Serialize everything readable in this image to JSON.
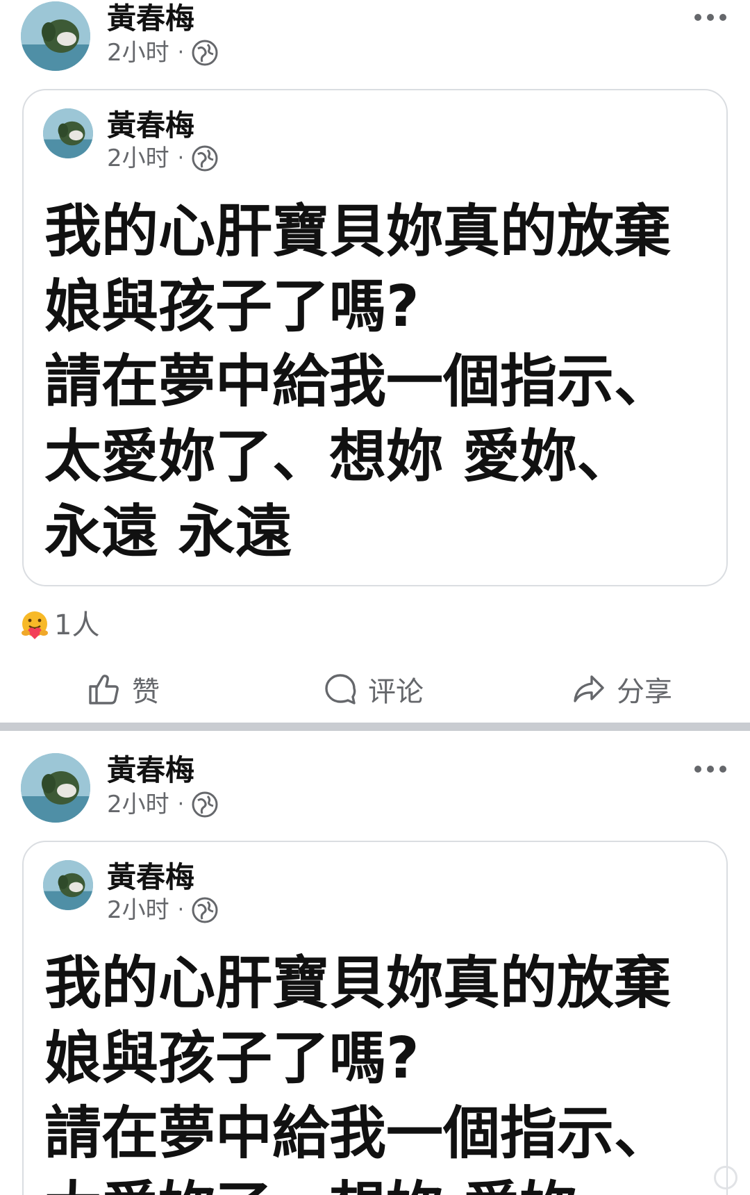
{
  "posts": [
    {
      "author": "黃春梅",
      "time": "2小时",
      "separator": "·",
      "shared_card": {
        "author": "黃春梅",
        "time": "2小时",
        "separator": "·",
        "text": "我的心肝寶貝妳真的放棄\n娘與孩子了嗎?\n請在夢中給我一個指示、\n太愛妳了、想妳 愛妳、\n永遠 永遠"
      },
      "reaction_count": "1人",
      "actions": {
        "like": "赞",
        "comment": "评论",
        "share": "分享"
      }
    },
    {
      "author": "黃春梅",
      "time": "2小时",
      "separator": "·",
      "shared_card": {
        "author": "黃春梅",
        "time": "2小时",
        "separator": "·",
        "text": "我的心肝寶貝妳真的放棄\n娘與孩子了嗎?\n請在夢中給我一個指示、\n太愛妳了、想妳 愛妳、"
      }
    }
  ],
  "icons": {
    "more": "more-horizontal-icon",
    "audience": "globe-icon",
    "reaction": "care-reaction-icon",
    "like": "thumbs-up-icon",
    "comment": "comment-bubble-icon",
    "share": "share-arrow-icon"
  },
  "colors": {
    "text_primary": "#050505",
    "text_secondary": "#65676b",
    "card_border": "#dadde1",
    "separator": "#c9ccd1",
    "reaction_yellow": "#f7b928",
    "reaction_heart": "#f33e58"
  }
}
